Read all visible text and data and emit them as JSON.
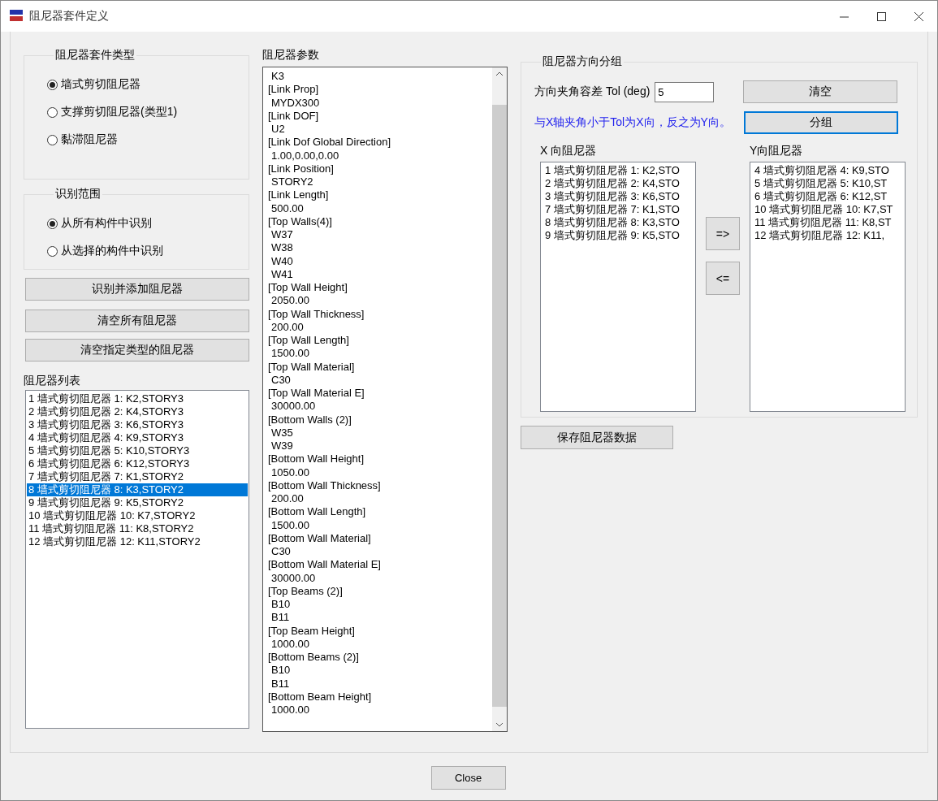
{
  "window": {
    "title": "阻尼器套件定义"
  },
  "damper_type": {
    "title": "阻尼器套件类型",
    "options": [
      {
        "label": "墙式剪切阻尼器",
        "selected": true
      },
      {
        "label": "支撑剪切阻尼器(类型1)",
        "selected": false
      },
      {
        "label": "黏滞阻尼器",
        "selected": false
      }
    ]
  },
  "scope": {
    "title": "识别范围",
    "options": [
      {
        "label": "从所有构件中识别",
        "selected": true
      },
      {
        "label": "从选择的构件中识别",
        "selected": false
      }
    ]
  },
  "action_buttons": [
    "识别并添加阻尼器",
    "清空所有阻尼器",
    "清空指定类型的阻尼器"
  ],
  "damper_list": {
    "title": "阻尼器列表",
    "items": [
      {
        "text": "1 墙式剪切阻尼器 1: K2,STORY3",
        "selected": false
      },
      {
        "text": "2 墙式剪切阻尼器 2: K4,STORY3",
        "selected": false
      },
      {
        "text": "3 墙式剪切阻尼器 3: K6,STORY3",
        "selected": false
      },
      {
        "text": "4 墙式剪切阻尼器 4: K9,STORY3",
        "selected": false
      },
      {
        "text": "5 墙式剪切阻尼器 5: K10,STORY3",
        "selected": false
      },
      {
        "text": "6 墙式剪切阻尼器 6: K12,STORY3",
        "selected": false
      },
      {
        "text": "7 墙式剪切阻尼器 7: K1,STORY2",
        "selected": false
      },
      {
        "text": "8 墙式剪切阻尼器 8: K3,STORY2",
        "selected": true
      },
      {
        "text": "9 墙式剪切阻尼器 9: K5,STORY2",
        "selected": false
      },
      {
        "text": "10 墙式剪切阻尼器 10: K7,STORY2",
        "selected": false
      },
      {
        "text": "11 墙式剪切阻尼器 11: K8,STORY2",
        "selected": false
      },
      {
        "text": "12 墙式剪切阻尼器 12: K11,STORY2",
        "selected": false
      }
    ]
  },
  "params": {
    "title": "阻尼器参数",
    "lines": [
      "K3",
      "[Link Prop]",
      "MYDX300",
      "[Link DOF]",
      "U2",
      "[Link Dof Global Direction]",
      "1.00,0.00,0.00",
      "[Link Position]",
      "STORY2",
      "[Link Length]",
      "500.00",
      "[Top Walls(4)]",
      "W37",
      "W38",
      "W40",
      "W41",
      "[Top Wall Height]",
      "2050.00",
      "[Top Wall Thickness]",
      "200.00",
      "[Top Wall Length]",
      "1500.00",
      "[Top Wall Material]",
      "C30",
      "[Top Wall Material E]",
      "30000.00",
      "[Bottom Walls (2)]",
      "W35",
      "W39",
      "[Bottom Wall Height]",
      "1050.00",
      "[Bottom Wall Thickness]",
      "200.00",
      "[Bottom Wall Length]",
      "1500.00",
      "[Bottom Wall Material]",
      "C30",
      "[Bottom Wall Material E]",
      "30000.00",
      "[Top Beams (2)]",
      "B10",
      "B11",
      "[Top Beam Height]",
      "1000.00",
      "[Bottom Beams (2)]",
      "B10",
      "B11",
      "[Bottom Beam Height]",
      "1000.00"
    ]
  },
  "grouping": {
    "title": "阻尼器方向分组",
    "tol_label": "方向夹角容差 Tol (deg)",
    "tol_value": "5",
    "clear_button": "清空",
    "group_button": "分组",
    "hint": "与X轴夹角小于Tol为X向，反之为Y向。",
    "x_list": {
      "title": "X 向阻尼器",
      "items": [
        "1 墙式剪切阻尼器 1: K2,STO",
        "2 墙式剪切阻尼器 2: K4,STO",
        "3 墙式剪切阻尼器 3: K6,STO",
        "7 墙式剪切阻尼器 7: K1,STO",
        "8 墙式剪切阻尼器 8: K3,STO",
        "9 墙式剪切阻尼器 9: K5,STO"
      ]
    },
    "move_right": "=>",
    "move_left": "<=",
    "y_list": {
      "title": "Y向阻尼器",
      "items": [
        "4 墙式剪切阻尼器 4: K9,STO",
        "5 墙式剪切阻尼器 5: K10,ST",
        "6 墙式剪切阻尼器 6: K12,ST",
        "10 墙式剪切阻尼器 10: K7,ST",
        "11 墙式剪切阻尼器 11: K8,ST",
        "12 墙式剪切阻尼器 12: K11,"
      ]
    }
  },
  "save_button": "保存阻尼器数据",
  "close_button": "Close"
}
